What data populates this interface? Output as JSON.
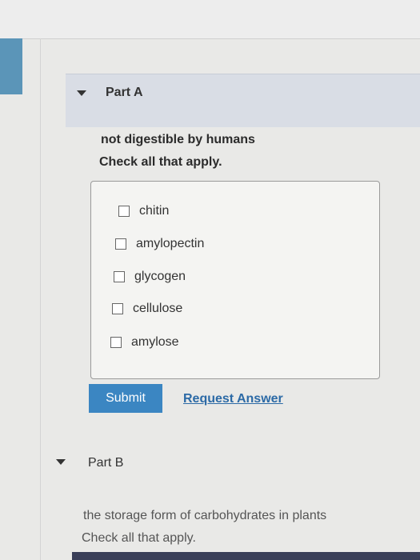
{
  "part_a": {
    "title": "Part A",
    "prompt": "not digestible by humans",
    "instruction": "Check all that apply.",
    "options": [
      {
        "label": "chitin",
        "checked": false
      },
      {
        "label": "amylopectin",
        "checked": false
      },
      {
        "label": "glycogen",
        "checked": false
      },
      {
        "label": "cellulose",
        "checked": false
      },
      {
        "label": "amylose",
        "checked": false
      }
    ],
    "submit_label": "Submit",
    "request_answer_label": "Request Answer"
  },
  "part_b": {
    "title": "Part B",
    "prompt": "the storage form of carbohydrates in plants",
    "instruction": "Check all that apply."
  },
  "colors": {
    "submit_bg": "#3b86c2",
    "link": "#2c6aa6",
    "header_bg": "#d9dde5"
  }
}
